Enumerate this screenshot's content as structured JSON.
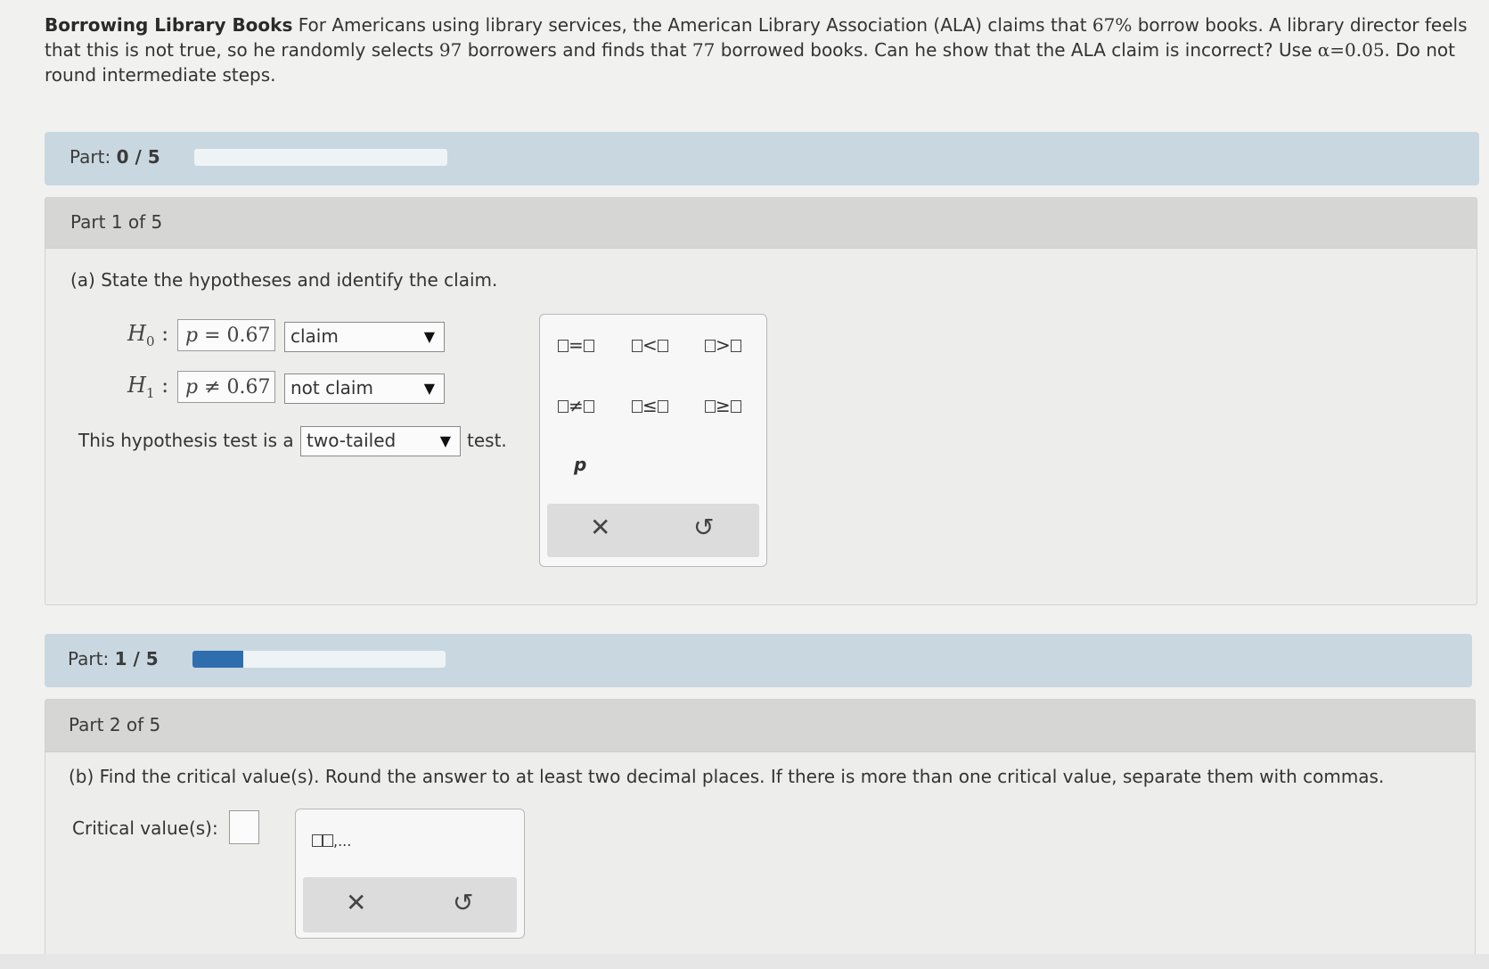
{
  "problem": {
    "title": "Borrowing Library Books",
    "text_1": " For Americans using library services, the American Library Association (ALA) claims that ",
    "pct": "67%",
    "text_2": " borrow books. A library director feels that this is not true, so he randomly selects ",
    "n": "97",
    "text_3": " borrowers and finds that ",
    "x": "77",
    "text_4": " borrowed books. Can he show that the ALA claim is incorrect? Use ",
    "alpha": "α=0.05",
    "text_5": ". Do not round intermediate steps."
  },
  "progress_1": {
    "label": "Part:",
    "value": "0 / 5",
    "fraction": 0.0
  },
  "part1": {
    "header": "Part 1 of 5",
    "question": "(a) State the hypotheses and identify the claim.",
    "h0": {
      "label": "H",
      "sub": "0",
      "colon": ":",
      "answer": "p = 0.67",
      "select": "claim"
    },
    "h1": {
      "label": "H",
      "sub": "1",
      "colon": ":",
      "answer": "p ≠ 0.67",
      "select": "not claim"
    },
    "test_prefix": "This hypothesis test is a",
    "test_select": "two-tailed",
    "test_suffix": "test.",
    "palette": {
      "eq": "=",
      "lt": "<",
      "gt": ">",
      "ne": "≠",
      "le": "≤",
      "ge": "≥",
      "var": "p",
      "clear": "✕",
      "undo": "↺"
    }
  },
  "progress_2": {
    "label": "Part:",
    "value": "1 / 5",
    "fraction": 0.2
  },
  "part2": {
    "header": "Part 2 of 5",
    "question": "(b) Find the critical value(s). Round the answer to at least two decimal places. If there is more than one critical value, separate them with commas.",
    "cv_label": "Critical value(s):",
    "palette": {
      "list_suffix": ",...",
      "clear": "✕",
      "undo": "↺"
    }
  },
  "colors": {
    "progress_fill": "#2f6eae",
    "part_bar": "#c9d7e0",
    "part_head": "#d6d6d5"
  }
}
